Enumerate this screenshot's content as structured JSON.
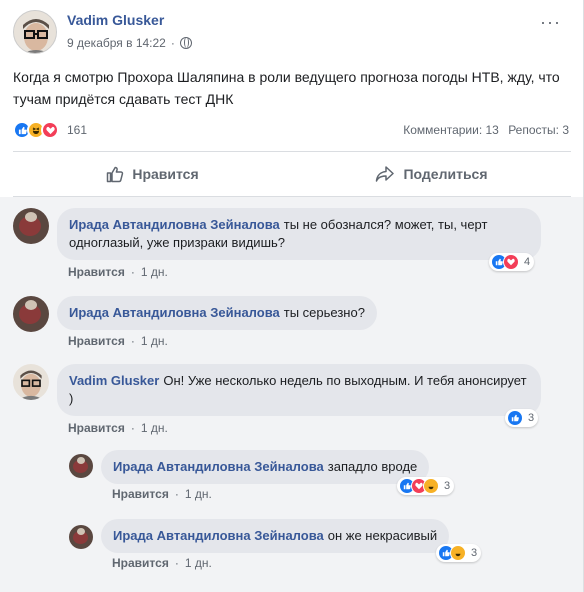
{
  "post": {
    "author": "Vadim Glusker",
    "date": "9 декабря в 14:22",
    "more": "···",
    "text": "Когда я смотрю Прохора Шаляпина в роли ведущего прогноза погоды НТВ, жду, что тучам придётся сдавать тест ДНК",
    "reaction_count": "161",
    "comments_label": "Комментарии: 13",
    "shares_label": "Репосты: 3",
    "like_action": "Нравится",
    "share_action": "Поделиться"
  },
  "comments": [
    {
      "author": "Ирада Автандиловна Зейналова",
      "text": "ты не обознался? может, ты, черт одноглазый, уже призраки видишь?",
      "like": "Нравится",
      "time": "1 дн.",
      "reactions": "4"
    },
    {
      "author": "Ирада Автандиловна Зейналова",
      "text": "ты серьезно?",
      "like": "Нравится",
      "time": "1 дн."
    },
    {
      "author": "Vadim Glusker",
      "text": "Он! Уже несколько недель по выходным. И тебя анонсирует )",
      "like": "Нравится",
      "time": "1 дн.",
      "reactions": "3"
    }
  ],
  "replies": [
    {
      "author": "Ирада Автандиловна Зейналова",
      "text": "западло вроде",
      "like": "Нравится",
      "time": "1 дн.",
      "reactions": "3"
    },
    {
      "author": "Ирада Автандиловна Зейналова",
      "text": "он же некрасивый",
      "like": "Нравится",
      "time": "1 дн.",
      "reactions": "3"
    }
  ],
  "separator": "·",
  "colors": {
    "link": "#385898",
    "like": "#1877f2",
    "haha": "#f7b125",
    "love": "#f33e58"
  },
  "icons": [
    "globe-icon",
    "like-reaction-icon",
    "haha-reaction-icon",
    "love-reaction-icon",
    "thumb-up-icon",
    "share-arrow-icon"
  ]
}
